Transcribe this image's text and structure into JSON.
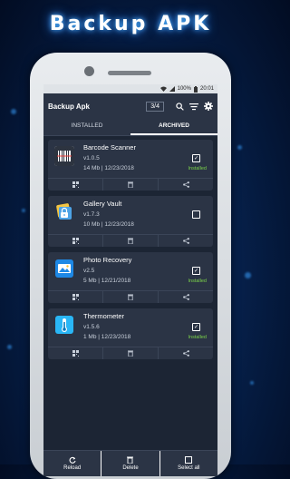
{
  "promo_title": "Backup APK",
  "status_bar": {
    "battery": "100%",
    "time": "20:01"
  },
  "appbar": {
    "title": "Backup Apk",
    "counter": "3/4"
  },
  "tabs": [
    {
      "label": "INSTALLED",
      "active": false
    },
    {
      "label": "ARCHIVED",
      "active": true
    }
  ],
  "apps": [
    {
      "name": "Barcode Scanner",
      "version": "v1.0.5",
      "meta": "14 Mb | 12/23/2018",
      "checked": true,
      "status": "Installed",
      "icon": "barcode-icon"
    },
    {
      "name": "Gallery Vault",
      "version": "v1.7.3",
      "meta": "10 Mb | 12/23/2018",
      "checked": false,
      "status": "",
      "icon": "lock-gallery-icon"
    },
    {
      "name": "Photo Recovery",
      "version": "v2.5",
      "meta": "5 Mb | 12/21/2018",
      "checked": true,
      "status": "Installed",
      "icon": "photo-icon"
    },
    {
      "name": "Thermometer",
      "version": "v1.5.6",
      "meta": "1 Mb | 12/23/2018",
      "checked": true,
      "status": "Installed",
      "icon": "thermometer-icon"
    }
  ],
  "bottom_bar": {
    "reload": "Reload",
    "delete": "Delete",
    "select_all": "Select all"
  },
  "colors": {
    "installed_green": "#7bd24a",
    "card_bg": "#2b3445",
    "screen_bg": "#1c2534"
  }
}
